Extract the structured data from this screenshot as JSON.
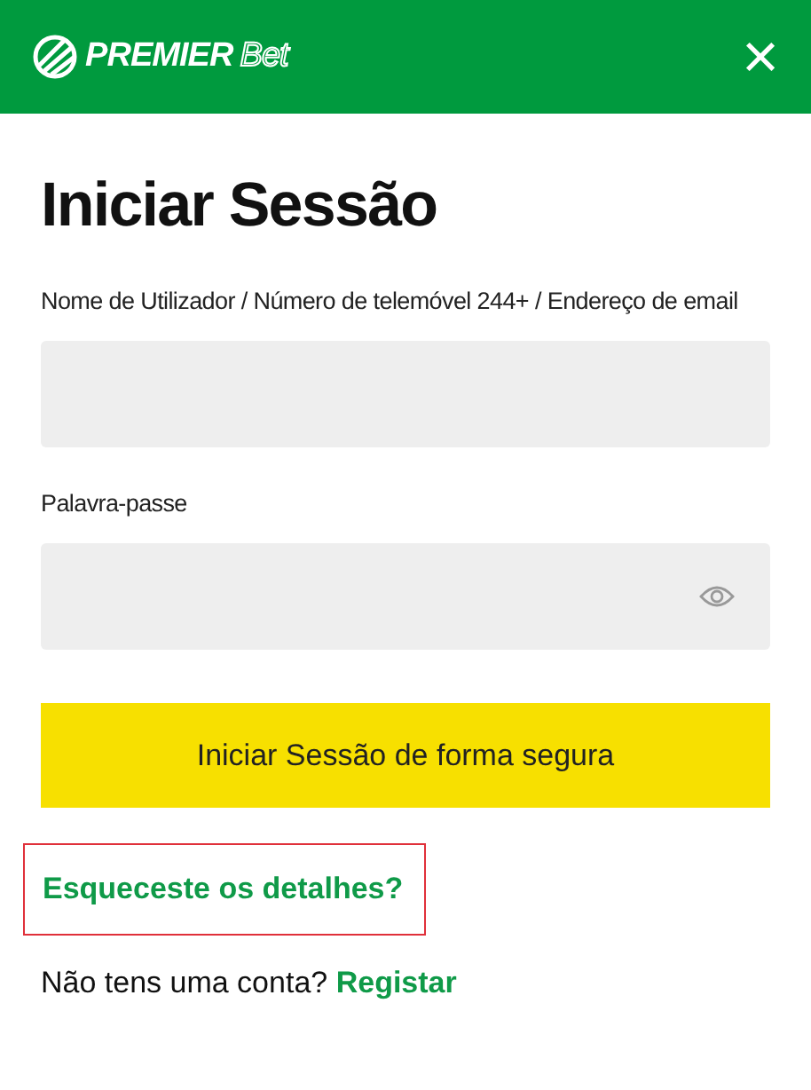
{
  "header": {
    "logo": {
      "word_1": "PREMIER",
      "word_2": "Bet"
    },
    "close": "×"
  },
  "title": "Iniciar Sessão",
  "fields": [
    {
      "kind": "text",
      "label": "Nome de Utilizador / Número de telemóvel 244+ / Endereço de email"
    },
    {
      "kind": "password",
      "label": "Palavra-passe"
    }
  ],
  "submit": "Iniciar Sessão de forma segura",
  "forgot": {
    "label": "Esqueceste os detalhes?",
    "highlighted": true
  },
  "signup": {
    "text": "Não tens uma conta?",
    "link": "Registar"
  }
}
